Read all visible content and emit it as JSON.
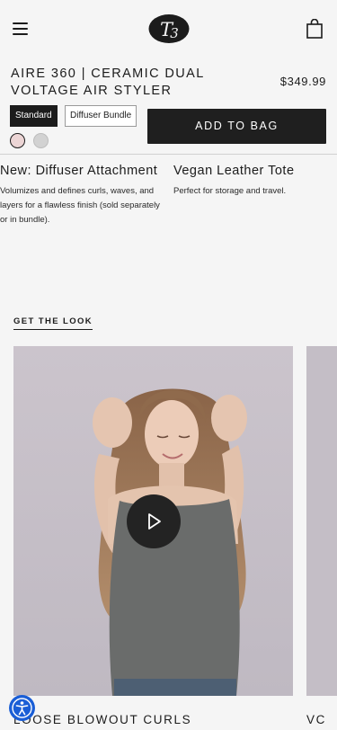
{
  "header": {
    "logo_text": "T3",
    "menu_icon": "hamburger-menu-icon",
    "bag_icon": "shopping-bag-icon"
  },
  "product": {
    "name": "AIRE 360 | CERAMIC DUAL VOLTAGE AIR STYLER",
    "price": "$349.99",
    "variants": [
      {
        "label": "Standard",
        "selected": true
      },
      {
        "label": "Diffuser Bundle",
        "selected": false
      }
    ],
    "swatches": [
      {
        "color": "#ecd5d5",
        "selected": true
      },
      {
        "color": "#d2d2d2",
        "selected": false
      }
    ],
    "add_to_bag_label": "ADD TO BAG"
  },
  "features": [
    {
      "title": "New: Diffuser Attachment",
      "description": "Volumizes and defines curls, waves, and layers for a flawless finish (sold separately or in bundle)."
    },
    {
      "title": "Vegan Leather Tote",
      "description": "Perfect for storage and travel."
    }
  ],
  "get_the_look": {
    "heading": "GET THE LOOK",
    "cards": [
      {
        "title": "LOOSE BLOWOUT CURLS",
        "media": "video",
        "play_icon": "play-icon"
      },
      {
        "title": "VC"
      }
    ]
  },
  "accessibility": {
    "icon": "accessibility-icon"
  },
  "colors": {
    "primary": "#1c1c1c",
    "background": "#f5f5f5",
    "accessibility_blue": "#1a5ed6"
  }
}
